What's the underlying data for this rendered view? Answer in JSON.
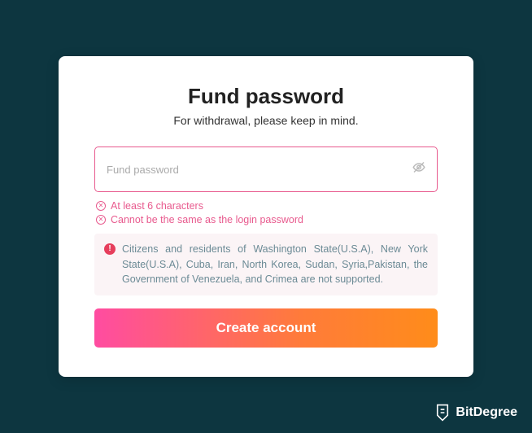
{
  "card": {
    "title": "Fund password",
    "subtitle": "For withdrawal, please keep in mind.",
    "input": {
      "placeholder": "Fund password",
      "value": ""
    },
    "validations": [
      "At least 6 characters",
      "Cannot be the same as the login password"
    ],
    "warning": "Citizens and residents of Washington State(U.S.A), New York State(U.S.A), Cuba, Iran, North Korea, Sudan, Syria,Pakistan, the Government of Venezuela, and Crimea are not supported.",
    "button_label": "Create account"
  },
  "brand": {
    "name": "BitDegree"
  }
}
